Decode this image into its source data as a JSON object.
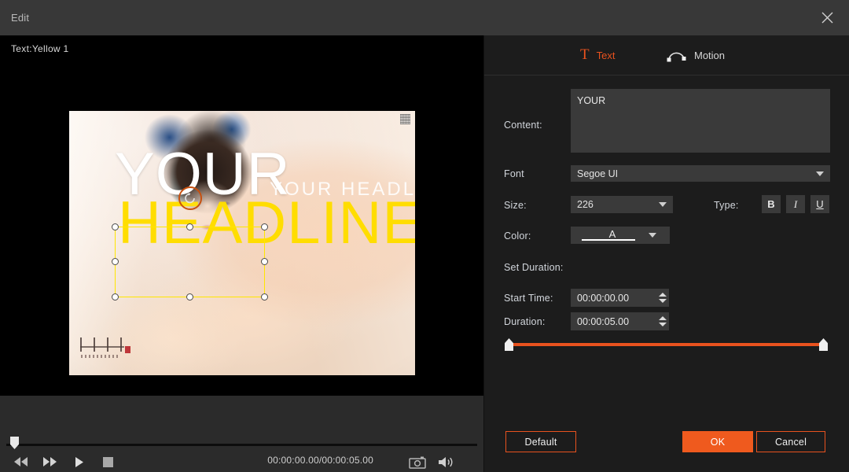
{
  "window": {
    "title": "Edit",
    "close_icon": "close-icon"
  },
  "preview": {
    "clip_label": "Text:Yellow 1",
    "overlay": {
      "selected_text": "YOUR",
      "second_line": "HEADLINE",
      "watermark_text": "YOUR  HEADLINE",
      "selection_color": "#ffe600",
      "rotate_icon": "rotate-icon"
    },
    "watermarks": {
      "qr_icon": "qr-watermark-icon",
      "logo_icon": "calligraphy-logo-watermark"
    }
  },
  "transport": {
    "rewind_icon": "rewind-icon",
    "forward_icon": "fast-forward-icon",
    "play_icon": "play-icon",
    "stop_icon": "stop-icon",
    "timecode": "00:00:00.00/00:00:05.00",
    "snapshot_icon": "camera-icon",
    "volume_icon": "speaker-icon",
    "playhead_position": "0%"
  },
  "panel": {
    "tabs": [
      {
        "label": "Text",
        "icon": "text-t-icon",
        "active": true
      },
      {
        "label": "Motion",
        "icon": "motion-arc-icon",
        "active": false
      }
    ],
    "fields": {
      "content_label": "Content:",
      "content_value": "YOUR",
      "font_label": "Font",
      "font_value": "Segoe UI",
      "size_label": "Size:",
      "size_value": "226",
      "type_label": "Type:",
      "type_buttons": [
        "B",
        "I",
        "U"
      ],
      "color_label": "Color:",
      "color_glyph": "A",
      "set_duration_label": "Set Duration:",
      "start_time_label": "Start Time:",
      "start_time_value": "00:00:00.00",
      "duration_label": "Duration:",
      "duration_value": "00:00:05.00"
    },
    "buttons": {
      "default_label": "Default",
      "ok_label": "OK",
      "cancel_label": "Cancel"
    }
  },
  "colors": {
    "accent": "#e8521e",
    "ok_button": "#ef5a1e",
    "selection": "#ffe600",
    "headline_yellow": "#ffdd00",
    "panel_bg": "#1c1c1c",
    "titlebar_bg": "#383838"
  }
}
